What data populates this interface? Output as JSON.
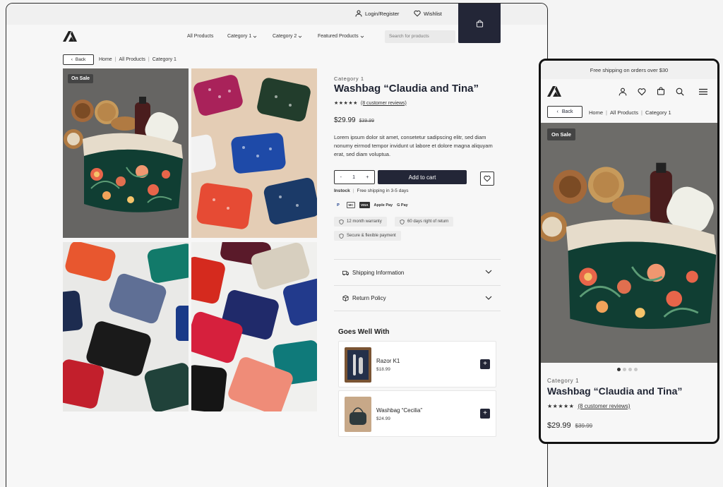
{
  "desktop": {
    "util": {
      "login": "Login/Register",
      "wishlist": "Wishlist"
    },
    "nav": [
      {
        "label": "All Products",
        "dropdown": false
      },
      {
        "label": "Category 1",
        "dropdown": true
      },
      {
        "label": "Category 2",
        "dropdown": true
      },
      {
        "label": "Featured Products",
        "dropdown": true
      }
    ],
    "search": {
      "placeholder": "Search for products"
    },
    "back": "Back",
    "breadcrumb": [
      "Home",
      "All Products",
      "Category 1"
    ],
    "badge": "On Sale",
    "product": {
      "category": "Category 1",
      "title": "Washbag “Claudia and Tina”",
      "stars": "★★★★★",
      "reviews": "(8 customer reviews)",
      "price": "$29.99",
      "old_price": "$39.99",
      "description": "Lorem ipsum dolor sit amet, consetetur sadipscing elitr, sed diam nonumy eirmod tempor invidunt ut labore et dolore magna aliquyam erat, sed diam voluptua.",
      "qty": "1",
      "qty_minus": "-",
      "qty_plus": "+",
      "add_to_cart": "Add to cart",
      "stock": "Instock",
      "shipping_note": "Free shipping in 3-5 days",
      "payments": [
        "P",
        "MC",
        "VISA",
        "Apple Pay",
        "G Pay"
      ],
      "chips": [
        "12 month warranty",
        "60 days right of return",
        "Secure & flexible payment"
      ]
    },
    "accordion": [
      "Shipping Information",
      "Return Policy"
    ],
    "goes_well": {
      "title": "Goes Well With",
      "items": [
        {
          "name": "Razor K1",
          "price": "$18.99"
        },
        {
          "name": "Washbag “Cecilia”",
          "price": "$24.99"
        }
      ]
    }
  },
  "mobile": {
    "shipping_bar": "Free shipping on orders over $30",
    "back": "Back",
    "breadcrumb": [
      "Home",
      "All Products",
      "Category 1"
    ],
    "badge": "On Sale",
    "category": "Category 1",
    "title": "Washbag “Claudia and Tina”",
    "stars": "★★★★★",
    "reviews": "(8 customer reviews)",
    "price": "$29.99",
    "old_price": "$39.99",
    "carousel_count": 4,
    "carousel_active": 1
  },
  "colors": {
    "dark": "#232637",
    "badge": "#444444",
    "bg": "#f7f7f7"
  }
}
